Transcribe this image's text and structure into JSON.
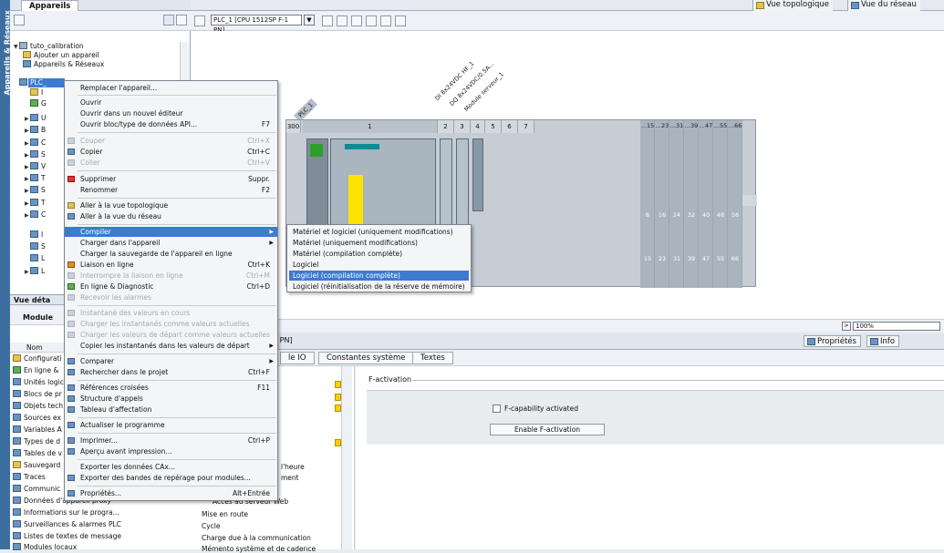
{
  "sidebar_tab": "Appareils & Réseaux",
  "tree": {
    "title": "Appareils",
    "items": [
      "tuto_calibration",
      "Ajouter un appareil",
      "Appareils & Réseaux",
      "PLC_",
      "I",
      "G",
      "U",
      "B",
      "C",
      "S",
      "V",
      "T",
      "S",
      "T",
      "C",
      "I",
      "S",
      "L",
      "L"
    ]
  },
  "detail": {
    "title": "Vue déta",
    "tab": "Module",
    "column": "Nom",
    "items": [
      "Configurati",
      "En ligne &",
      "Unités logic",
      "Blocs de pr",
      "Objets tech",
      "Sources ex",
      "Variables A",
      "Types de d",
      "Tables de v",
      "Sauvegard",
      "Traces",
      "Communic",
      "Données d'appareil proxy",
      "Informations sur le progra...",
      "Surveillances & alarmes PLC",
      "Listes de textes de message",
      "Modules locaux"
    ]
  },
  "topbar": {
    "topology": "Vue topologique",
    "network": "Vue du réseau"
  },
  "device_selector": "PLC_1 [CPU 1512SP F-1 PN]",
  "canvas": {
    "plc_tag": "PLC_1",
    "module_labels": [
      "DI 8x24VDC HF_1",
      "DQ 8x24VDC/0.5A...",
      "Module serveur_1"
    ],
    "slots": [
      "300",
      "1",
      "2",
      "3",
      "4",
      "5",
      "6",
      "7"
    ],
    "exp_headers": [
      "...15",
      "...23",
      "...31",
      "...39",
      "...47",
      "...55",
      "...66"
    ],
    "exp_row1": [
      "8",
      "16",
      "24",
      "32",
      "40",
      "48",
      "56"
    ],
    "exp_row2": [
      "15",
      "23",
      "31",
      "39",
      "47",
      "55",
      "66"
    ],
    "zoom": "100%"
  },
  "inspector": {
    "title": "1 PN]",
    "props": "Propriétés",
    "info": "Info",
    "tabs": [
      "le IO",
      "Constantes système",
      "Textes"
    ],
    "nav": [
      "l'heure",
      "ment",
      "Accès au serveur Web",
      "Mise en route",
      "Cycle",
      "Charge due à la communication",
      "Mémento système et de cadence"
    ],
    "section": "F-activation",
    "checkbox": "F-capability activated",
    "button": "Enable F-activation"
  },
  "context_menu": {
    "items": [
      {
        "label": "Remplacer l'appareil...",
        "shortcut": ""
      },
      {
        "label": "Ouvrir",
        "shortcut": ""
      },
      {
        "label": "Ouvrir dans un nouvel éditeur",
        "shortcut": ""
      },
      {
        "label": "Ouvrir bloc/type de données API...",
        "shortcut": "F7"
      },
      {
        "label": "Couper",
        "shortcut": "Ctrl+X"
      },
      {
        "label": "Copier",
        "shortcut": "Ctrl+C"
      },
      {
        "label": "Coller",
        "shortcut": "Ctrl+V"
      },
      {
        "label": "Supprimer",
        "shortcut": "Suppr."
      },
      {
        "label": "Renommer",
        "shortcut": "F2"
      },
      {
        "label": "Aller à la vue topologique",
        "shortcut": ""
      },
      {
        "label": "Aller à la vue du réseau",
        "shortcut": ""
      },
      {
        "label": "Compiler",
        "shortcut": ""
      },
      {
        "label": "Charger dans l'appareil",
        "shortcut": ""
      },
      {
        "label": "Charger la sauvegarde de l'appareil en ligne",
        "shortcut": ""
      },
      {
        "label": "Liaison en ligne",
        "shortcut": "Ctrl+K"
      },
      {
        "label": "Interrompre la liaison en ligne",
        "shortcut": "Ctrl+M"
      },
      {
        "label": "En ligne & Diagnostic",
        "shortcut": "Ctrl+D"
      },
      {
        "label": "Recevoir les alarmes",
        "shortcut": ""
      },
      {
        "label": "Instantané des valeurs en cours",
        "shortcut": ""
      },
      {
        "label": "Charger les instantanés comme valeurs actuelles",
        "shortcut": ""
      },
      {
        "label": "Charger les valeurs de départ comme valeurs actuelles",
        "shortcut": ""
      },
      {
        "label": "Copier les instantanés dans les valeurs de départ",
        "shortcut": ""
      },
      {
        "label": "Comparer",
        "shortcut": ""
      },
      {
        "label": "Rechercher dans le projet",
        "shortcut": "Ctrl+F"
      },
      {
        "label": "Références croisées",
        "shortcut": "F11"
      },
      {
        "label": "Structure d'appels",
        "shortcut": ""
      },
      {
        "label": "Tableau d'affectation",
        "shortcut": ""
      },
      {
        "label": "Actualiser le programme",
        "shortcut": ""
      },
      {
        "label": "Imprimer...",
        "shortcut": "Ctrl+P"
      },
      {
        "label": "Aperçu avant impression...",
        "shortcut": ""
      },
      {
        "label": "Exporter les données CAx...",
        "shortcut": ""
      },
      {
        "label": "Exporter des bandes de repérage pour modules...",
        "shortcut": ""
      },
      {
        "label": "Propriétés...",
        "shortcut": "Alt+Entrée"
      }
    ]
  },
  "submenu": {
    "items": [
      "Matériel et logiciel (uniquement modifications)",
      "Matériel (uniquement modifications)",
      "Matériel (compilation complète)",
      "Logiciel",
      "Logiciel (compilation complète)",
      "Logiciel (réinitialisation de la réserve de mémoire)"
    ]
  }
}
